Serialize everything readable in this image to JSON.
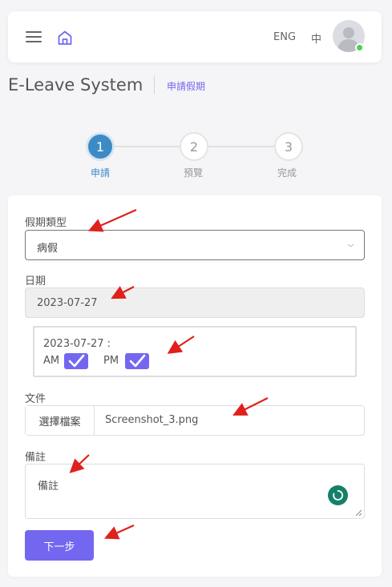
{
  "header": {
    "lang_en": "ENG",
    "lang_zh": "中",
    "menu_icon": "hamburger-icon",
    "home_icon": "home-icon",
    "user_status": "online"
  },
  "page": {
    "title": "E-Leave System",
    "breadcrumb": "申請假期"
  },
  "stepper": {
    "current_step": 1,
    "steps": [
      {
        "number": "1",
        "label": "申請"
      },
      {
        "number": "2",
        "label": "預覽"
      },
      {
        "number": "3",
        "label": "完成"
      }
    ]
  },
  "form": {
    "leave_type": {
      "label": "假期類型",
      "value": "病假"
    },
    "date": {
      "label": "日期",
      "value": "2023-07-27"
    },
    "half_day": {
      "date_text": "2023-07-27 :",
      "am_label": "AM",
      "am_checked": true,
      "pm_label": "PM",
      "pm_checked": true
    },
    "document": {
      "label": "文件",
      "button": "選擇檔案",
      "filename": "Screenshot_3.png"
    },
    "remarks": {
      "label": "備註",
      "placeholder": "備註"
    },
    "next_button": "下一步"
  },
  "colors": {
    "accent": "#7367f0",
    "step_active": "#3d8bc6",
    "annotation_arrow": "#e0201c",
    "online": "#4ccf58"
  }
}
